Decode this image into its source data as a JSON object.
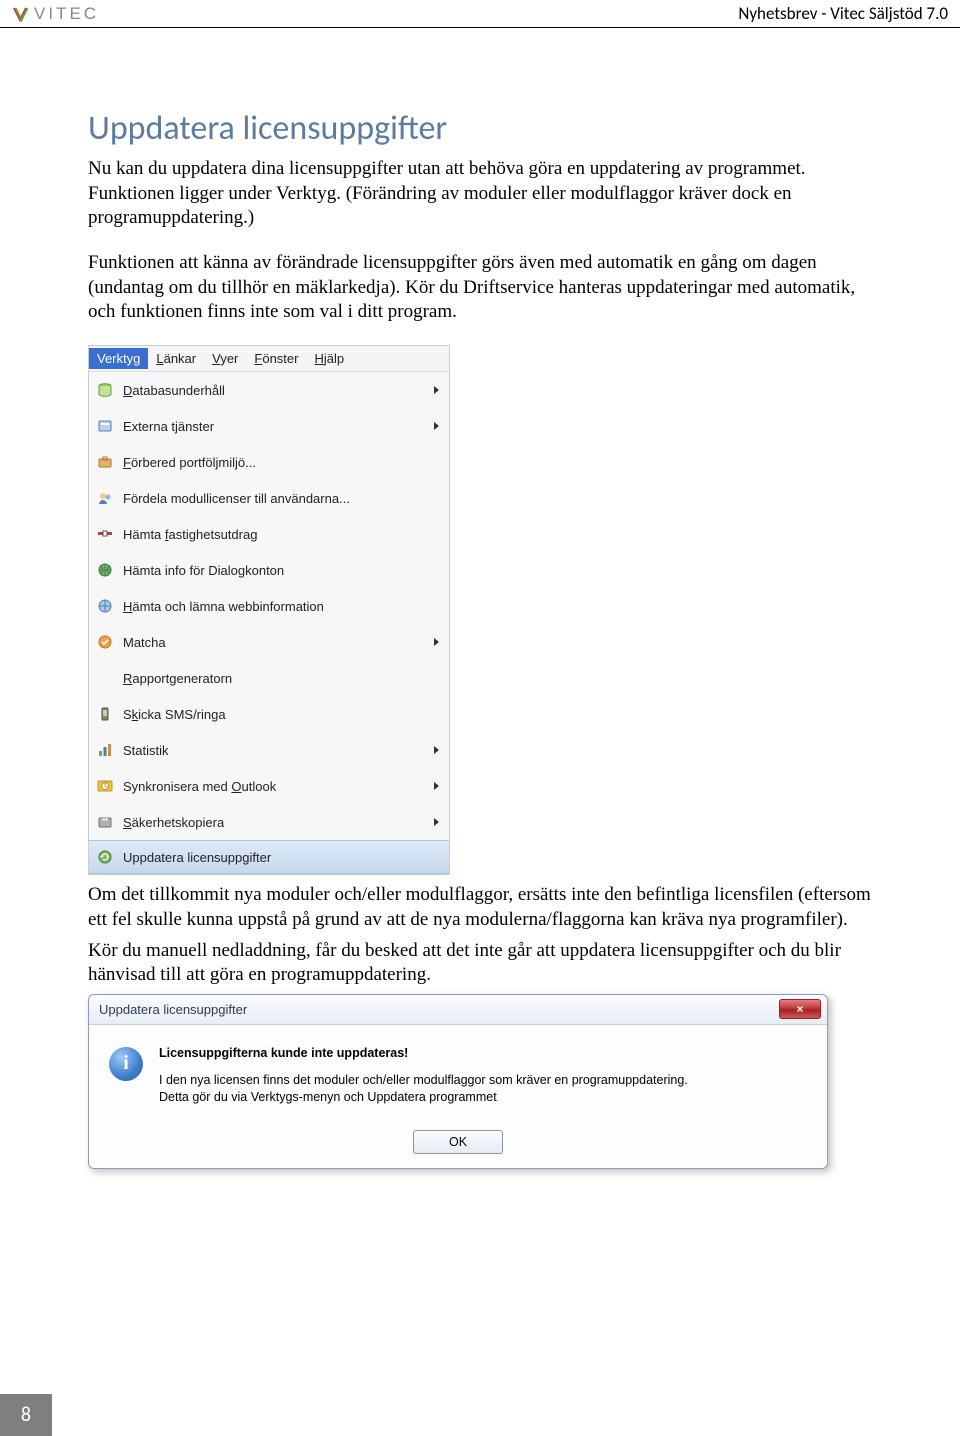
{
  "header": {
    "logo_text": "VITEC",
    "newsletter": "Nyhetsbrev - Vitec Säljstöd 7.0"
  },
  "heading": "Uppdatera licensuppgifter",
  "para1": "Nu kan du uppdatera dina licensuppgifter utan att behöva göra en uppdatering av programmet. Funktionen ligger under Verktyg. (Förändring av moduler eller modulflaggor kräver dock en programuppdatering.)",
  "para2": "Funktionen att känna av förändrade licensuppgifter görs även med automatik en gång om dagen (undantag om du tillhör en mäklarkedja). Kör du Driftservice hanteras uppdateringar med automatik, och funktionen finns inte som val i ditt program.",
  "menu": {
    "bar": {
      "verktyg": "Verktyg",
      "lankar": "Länkar",
      "vyer": "Vyer",
      "fonster": "Fönster",
      "hjalp": "Hjälp"
    },
    "items": [
      {
        "label": "Databasunderhåll",
        "ul": "D",
        "icon": "database-icon",
        "submenu": true
      },
      {
        "label": "Externa tjänster",
        "ul": "",
        "icon": "services-icon",
        "submenu": true
      },
      {
        "label": "Förbered portföljmiljö...",
        "ul": "F",
        "icon": "briefcase-icon",
        "submenu": false
      },
      {
        "label": "Fördela modullicenser till användarna...",
        "ul": "",
        "icon": "users-icon",
        "submenu": false
      },
      {
        "label": "Hämta fastighetsutdrag",
        "ul": "f",
        "icon": "property-icon",
        "submenu": false
      },
      {
        "label": "Hämta info för Dialogkonton",
        "ul": "",
        "icon": "globe-icon",
        "submenu": false
      },
      {
        "label": "Hämta och lämna webbinformation",
        "ul": "H",
        "icon": "web-icon",
        "submenu": false
      },
      {
        "label": "Matcha",
        "ul": "",
        "icon": "match-icon",
        "submenu": true
      },
      {
        "label": "Rapportgeneratorn",
        "ul": "R",
        "icon": "",
        "submenu": false
      },
      {
        "label": "Skicka SMS/ringa",
        "ul": "k",
        "icon": "phone-icon",
        "submenu": false
      },
      {
        "label": "Statistik",
        "ul": "",
        "icon": "chart-icon",
        "submenu": true
      },
      {
        "label": "Synkronisera med Outlook",
        "ul": "O",
        "icon": "outlook-icon",
        "submenu": true
      },
      {
        "label": "Säkerhetskopiera",
        "ul": "S",
        "icon": "backup-icon",
        "submenu": true
      },
      {
        "label": "Uppdatera licensuppgifter",
        "ul": "",
        "icon": "update-icon",
        "submenu": false,
        "selected": true
      }
    ]
  },
  "para3": "Om det tillkommit nya moduler och/eller modulflaggor, ersätts inte den befintliga licensfilen (eftersom ett fel skulle kunna uppstå på grund av att de nya modulerna/flaggorna kan kräva nya programfiler).",
  "para4": "Kör du manuell nedladdning, får du besked att det inte går att uppdatera licensuppgifter och du blir hänvisad till att göra en programuppdatering.",
  "dialog": {
    "title": "Uppdatera licensuppgifter",
    "headline": "Licensuppgifterna kunde inte uppdateras!",
    "line1": "I den nya licensen finns det moduler och/eller modulflaggor som kräver en programuppdatering.",
    "line2": "Detta gör du via Verktygs-menyn och Uppdatera programmet",
    "ok": "OK",
    "close": "×"
  },
  "page_number": "8"
}
